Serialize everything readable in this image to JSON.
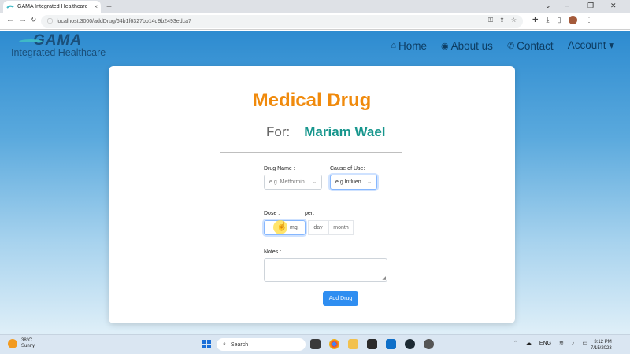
{
  "browser": {
    "tab_title": "GAMA Integrated Healthcare",
    "tab_close": "×",
    "new_tab": "+",
    "url": "localhost:3000/addDrug/64b1f6327bb14d9b2493edca7",
    "window_controls": [
      "⌄",
      "–",
      "❐",
      "✕"
    ]
  },
  "site": {
    "logo_top": "GAMA",
    "logo_sub": "Integrated Healthcare",
    "nav": [
      {
        "icon": "home-icon",
        "glyph": "⌂",
        "label": "Home"
      },
      {
        "icon": "user-circle-icon",
        "glyph": "◉",
        "label": "About us"
      },
      {
        "icon": "phone-icon",
        "glyph": "✆",
        "label": "Contact"
      },
      {
        "icon": "",
        "glyph": "",
        "label": "Account ▾"
      }
    ]
  },
  "form": {
    "title": "Medical Drug",
    "for_label": "For:",
    "patient_name": "Mariam Wael",
    "drug_name_label": "Drug Name :",
    "drug_name_placeholder": "e.g. Metformin",
    "cause_label": "Cause of Use:",
    "cause_placeholder": "e.g.Influen",
    "dose_label": "Dose :",
    "dose_unit": "mg.",
    "per_label": "per:",
    "per_options": [
      "day",
      "month"
    ],
    "notes_label": "Notes :",
    "submit_label": "Add Drug"
  },
  "taskbar": {
    "weather_temp": "38°C",
    "weather_cond": "Sunny",
    "search_label": "Search",
    "lang": "ENG",
    "time": "3:12 PM",
    "date": "7/15/2023"
  },
  "colors": {
    "title_orange": "#f08a0c",
    "patient_teal": "#17968d",
    "button_blue": "#2f8ef1",
    "nav_dark": "#0d3d63"
  }
}
